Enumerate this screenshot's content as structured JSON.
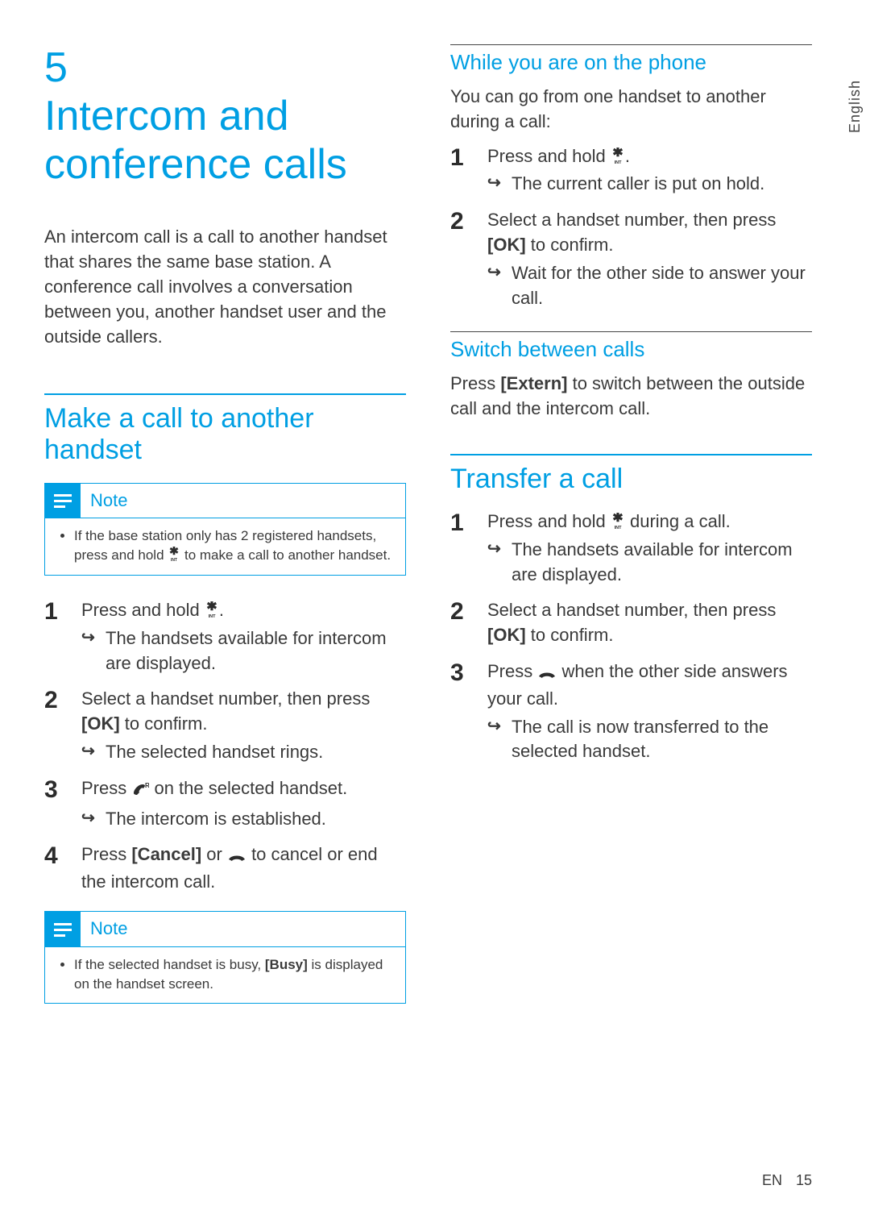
{
  "language_tab": "English",
  "chapter": {
    "num": "5",
    "title": "Intercom and conference calls"
  },
  "intro": "An intercom call is a call to another handset that shares the same base station. A conference call involves a conversation between you, another handset user and the outside callers.",
  "left": {
    "section_title": "Make a call to another handset",
    "note_label": "Note",
    "note1_a": "If the base station only has 2 registered handsets, press and hold ",
    "note1_b": " to make a call to another handset.",
    "steps": {
      "s1_a": "Press and hold ",
      "s1_b": ".",
      "s1_res": "The handsets available for intercom are displayed.",
      "s2_a": "Select a handset number, then press ",
      "s2_ok": "[OK]",
      "s2_b": " to confirm.",
      "s2_res": "The selected handset rings.",
      "s3_a": "Press ",
      "s3_b": " on the selected handset.",
      "s3_res": "The intercom is established.",
      "s4_a": "Press ",
      "s4_cancel": "[Cancel]",
      "s4_b": " or ",
      "s4_c": " to cancel or end the intercom call."
    },
    "note2_a": "If the selected handset is busy, ",
    "note2_busy": "[Busy]",
    "note2_b": " is displayed on the handset screen."
  },
  "right": {
    "sub1_title": "While you are on the phone",
    "sub1_intro": "You can go from one handset to another during a call:",
    "sub1_s1_a": "Press and hold ",
    "sub1_s1_b": ".",
    "sub1_s1_res": "The current caller is put on hold.",
    "sub1_s2_a": "Select a handset number, then press ",
    "sub1_s2_ok": "[OK]",
    "sub1_s2_b": " to confirm.",
    "sub1_s2_res": "Wait for the other side to answer your call.",
    "sub2_title": "Switch between calls",
    "sub2_body_a": "Press ",
    "sub2_body_extern": "[Extern]",
    "sub2_body_b": " to switch between the outside call and the intercom call.",
    "section2_title": "Transfer a call",
    "t_s1_a": "Press and hold ",
    "t_s1_b": " during a call.",
    "t_s1_res": "The handsets available for intercom are displayed.",
    "t_s2_a": "Select a handset number, then press ",
    "t_s2_ok": "[OK]",
    "t_s2_b": " to confirm.",
    "t_s3_a": "Press ",
    "t_s3_b": " when the other side answers your call.",
    "t_s3_res": "The call is now transferred to the selected handset."
  },
  "footer": {
    "lang": "EN",
    "page": "15"
  }
}
